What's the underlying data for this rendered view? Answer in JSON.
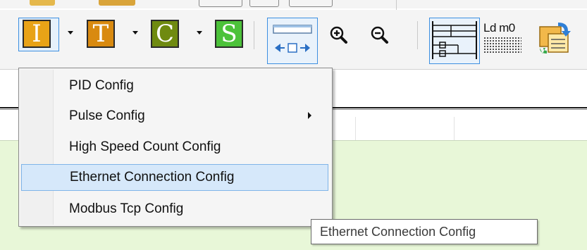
{
  "toolbar": {
    "buttons": [
      {
        "letter": "I",
        "color": "#e8a317"
      },
      {
        "letter": "T",
        "color": "#d98a10"
      },
      {
        "letter": "C",
        "color": "#6f8a10"
      },
      {
        "letter": "S",
        "color": "#4cc23a"
      }
    ],
    "icons": [
      "layout-icon",
      "zoom-in-icon",
      "zoom-out-icon",
      "ladder-diagram-icon",
      "instruction-list-icon",
      "convert-icon"
    ],
    "instruction_label": "Ld m0"
  },
  "menu": {
    "items": [
      {
        "label": "PID Config",
        "has_submenu": false
      },
      {
        "label": "Pulse Config",
        "has_submenu": true
      },
      {
        "label": "High Speed Count Config",
        "has_submenu": false
      },
      {
        "label": "Ethernet Connection Config",
        "has_submenu": false,
        "highlighted": true
      },
      {
        "label": "Modbus Tcp Config",
        "has_submenu": false
      }
    ]
  },
  "tooltip": {
    "text": "Ethernet Connection Config"
  },
  "colors": {
    "accent": "#3d8fe0",
    "menu_highlight": "#d6e8fa",
    "workspace": "#e8f7d8"
  }
}
